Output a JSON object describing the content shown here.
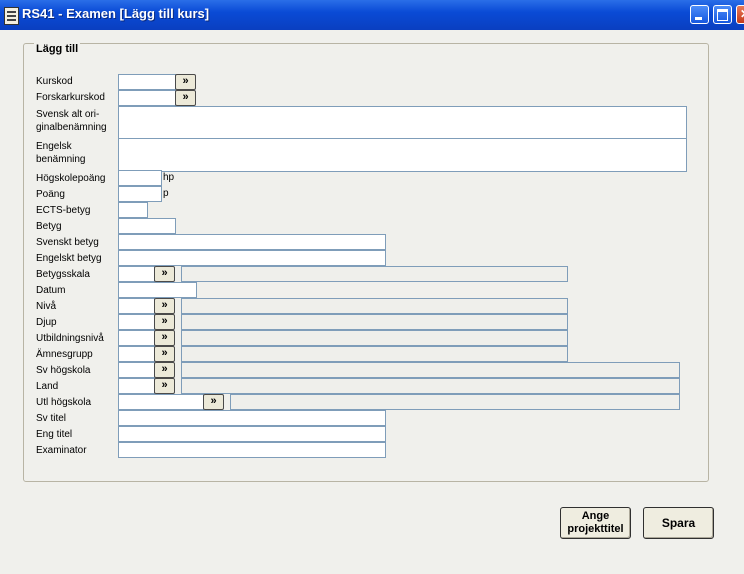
{
  "window": {
    "title": "RS41 - Examen [Lägg till kurs]"
  },
  "group": {
    "legend": "Lägg till"
  },
  "fields": {
    "kurskod": {
      "label": "Kurskod",
      "value": ""
    },
    "forskarkurskod": {
      "label": "Forskarkurskod",
      "value": ""
    },
    "svensk_alt_1": "Svensk alt ori-",
    "svensk_alt_2": "ginalbenämning",
    "engelsk_1": "Engelsk",
    "engelsk_2": "benämning",
    "hogskolepoang": {
      "label": "Högskolepoäng",
      "unit": "hp"
    },
    "poang": {
      "label": "Poäng",
      "unit": "p"
    },
    "ects": {
      "label": "ECTS-betyg"
    },
    "betyg": {
      "label": "Betyg"
    },
    "svenskt_betyg": {
      "label": "Svenskt betyg"
    },
    "engelskt_betyg": {
      "label": "Engelskt betyg"
    },
    "betygsskala": {
      "label": "Betygsskala"
    },
    "datum": {
      "label": "Datum"
    },
    "niva": {
      "label": "Nivå"
    },
    "djup": {
      "label": "Djup"
    },
    "utbildningsniva": {
      "label": "Utbildningsnivå"
    },
    "amnesgrupp": {
      "label": "Ämnesgrupp"
    },
    "sv_hogskola": {
      "label": "Sv högskola"
    },
    "land": {
      "label": "Land"
    },
    "utl_hogskola": {
      "label": "Utl högskola"
    },
    "sv_titel": {
      "label": "Sv titel"
    },
    "eng_titel": {
      "label": "Eng titel"
    },
    "examinator": {
      "label": "Examinator"
    }
  },
  "lookup_glyph": "»",
  "buttons": {
    "ange_1": "Ange",
    "ange_2": "projekttitel",
    "spara": "Spara"
  }
}
